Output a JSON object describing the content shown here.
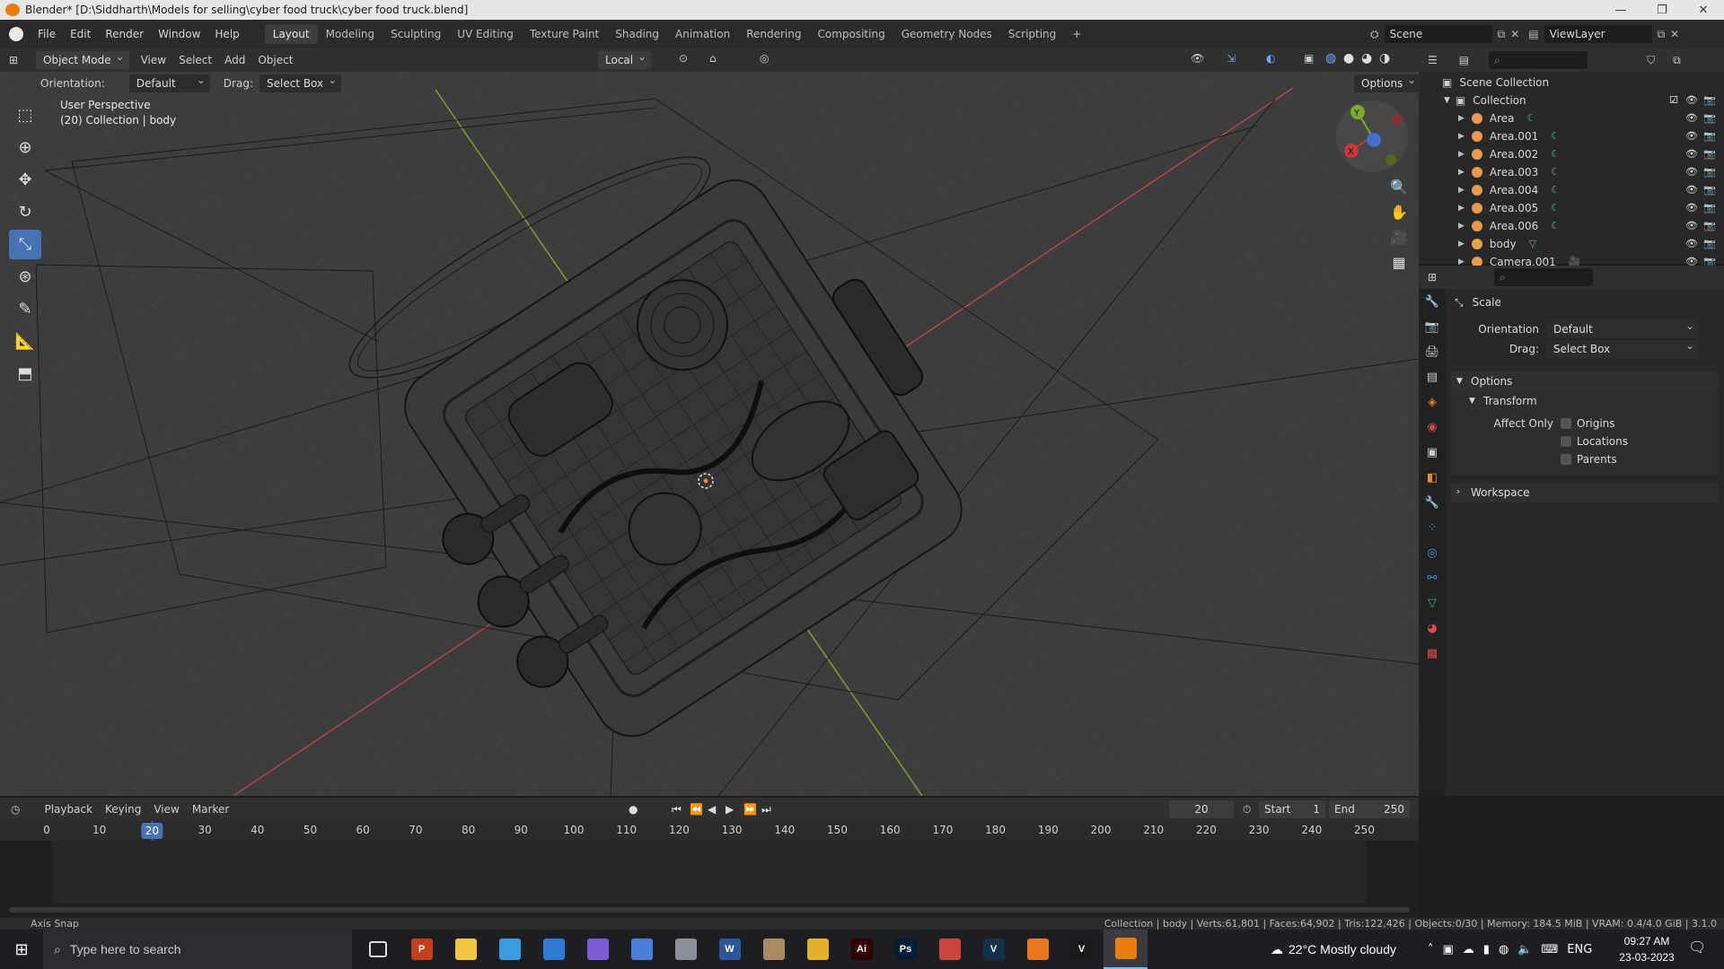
{
  "window": {
    "title": "Blender* [D:\\Siddharth\\Models for selling\\cyber food truck\\cyber food truck.blend]"
  },
  "topbar": {
    "menus": [
      "File",
      "Edit",
      "Render",
      "Window",
      "Help"
    ],
    "workspaces": [
      "Layout",
      "Modeling",
      "Sculpting",
      "UV Editing",
      "Texture Paint",
      "Shading",
      "Animation",
      "Rendering",
      "Compositing",
      "Geometry Nodes",
      "Scripting"
    ],
    "active_workspace": "Layout",
    "scene": "Scene",
    "view_layer": "ViewLayer"
  },
  "viewport_header": {
    "mode": "Object Mode",
    "menus": [
      "View",
      "Select",
      "Add",
      "Object"
    ],
    "transform_space": "Local",
    "options_label": "Options"
  },
  "tool_options": {
    "orientation_label": "Orientation:",
    "orientation_value": "Default",
    "drag_label": "Drag:",
    "drag_value": "Select Box"
  },
  "viewport": {
    "perspective": "User Perspective",
    "collection_info": "(20) Collection | body",
    "gizmo_axes": [
      "Y",
      "X",
      "Z"
    ]
  },
  "outliner": {
    "scene_collection": "Scene Collection",
    "collection": "Collection",
    "items": [
      {
        "name": "Area",
        "type": "light"
      },
      {
        "name": "Area.001",
        "type": "light"
      },
      {
        "name": "Area.002",
        "type": "light"
      },
      {
        "name": "Area.003",
        "type": "light"
      },
      {
        "name": "Area.004",
        "type": "light"
      },
      {
        "name": "Area.005",
        "type": "light"
      },
      {
        "name": "Area.006",
        "type": "light"
      },
      {
        "name": "body",
        "type": "mesh"
      },
      {
        "name": "Camera.001",
        "type": "camera"
      }
    ]
  },
  "properties": {
    "tool_name": "Scale",
    "orientation_label": "Orientation",
    "orientation_value": "Default",
    "drag_label": "Drag:",
    "drag_value": "Select Box",
    "options_panel": "Options",
    "transform_panel": "Transform",
    "affect_only_label": "Affect Only",
    "affect_only": [
      "Origins",
      "Locations",
      "Parents"
    ],
    "workspace_panel": "Workspace"
  },
  "timeline": {
    "menus": [
      "Playback",
      "Keying",
      "View",
      "Marker"
    ],
    "current_frame": "20",
    "start_label": "Start",
    "start": "1",
    "end_label": "End",
    "end": "250",
    "ruler": [
      "0",
      "10",
      "20",
      "30",
      "40",
      "50",
      "60",
      "70",
      "80",
      "90",
      "100",
      "110",
      "120",
      "130",
      "140",
      "150",
      "160",
      "170",
      "180",
      "190",
      "200",
      "210",
      "220",
      "230",
      "240",
      "250"
    ]
  },
  "statusbar": {
    "left": "Axis Snap",
    "right": "Collection | body | Verts:61,801 | Faces:64,902 | Tris:122,426 | Objects:0/30 | Memory: 184.5 MiB | VRAM: 0.4/4.0 GiB | 3.1.0"
  },
  "taskbar": {
    "search_placeholder": "Type here to search",
    "weather": "22°C  Mostly cloudy",
    "language": "ENG",
    "time": "09:27 AM",
    "date": "23-03-2023",
    "apps": [
      {
        "name": "task-view",
        "label": "",
        "color": "#1d1e22"
      },
      {
        "name": "powerpoint",
        "label": "P",
        "color": "#c43e1c"
      },
      {
        "name": "file-explorer",
        "label": "",
        "color": "#f4c542"
      },
      {
        "name": "store",
        "label": "",
        "color": "#3a9be0"
      },
      {
        "name": "calendar",
        "label": "",
        "color": "#2e7bd6"
      },
      {
        "name": "app-purple",
        "label": "",
        "color": "#7b5cd6"
      },
      {
        "name": "app-blue",
        "label": "",
        "color": "#4a7fd9"
      },
      {
        "name": "app-gray",
        "label": "",
        "color": "#8a8f99"
      },
      {
        "name": "word",
        "label": "W",
        "color": "#2b579a"
      },
      {
        "name": "app-files",
        "label": "",
        "color": "#a88b62"
      },
      {
        "name": "chrome",
        "label": "",
        "color": "#e3b02a"
      },
      {
        "name": "illustrator",
        "label": "Ai",
        "color": "#330000"
      },
      {
        "name": "photoshop",
        "label": "Ps",
        "color": "#001e36"
      },
      {
        "name": "app-red",
        "label": "",
        "color": "#c8463b"
      },
      {
        "name": "vectorize",
        "label": "V",
        "color": "#12324a"
      },
      {
        "name": "vlc",
        "label": "",
        "color": "#e8781c"
      },
      {
        "name": "app-v2",
        "label": "V",
        "color": "#1a1a1a"
      },
      {
        "name": "blender",
        "label": "",
        "color": "#e87d0d"
      }
    ]
  }
}
